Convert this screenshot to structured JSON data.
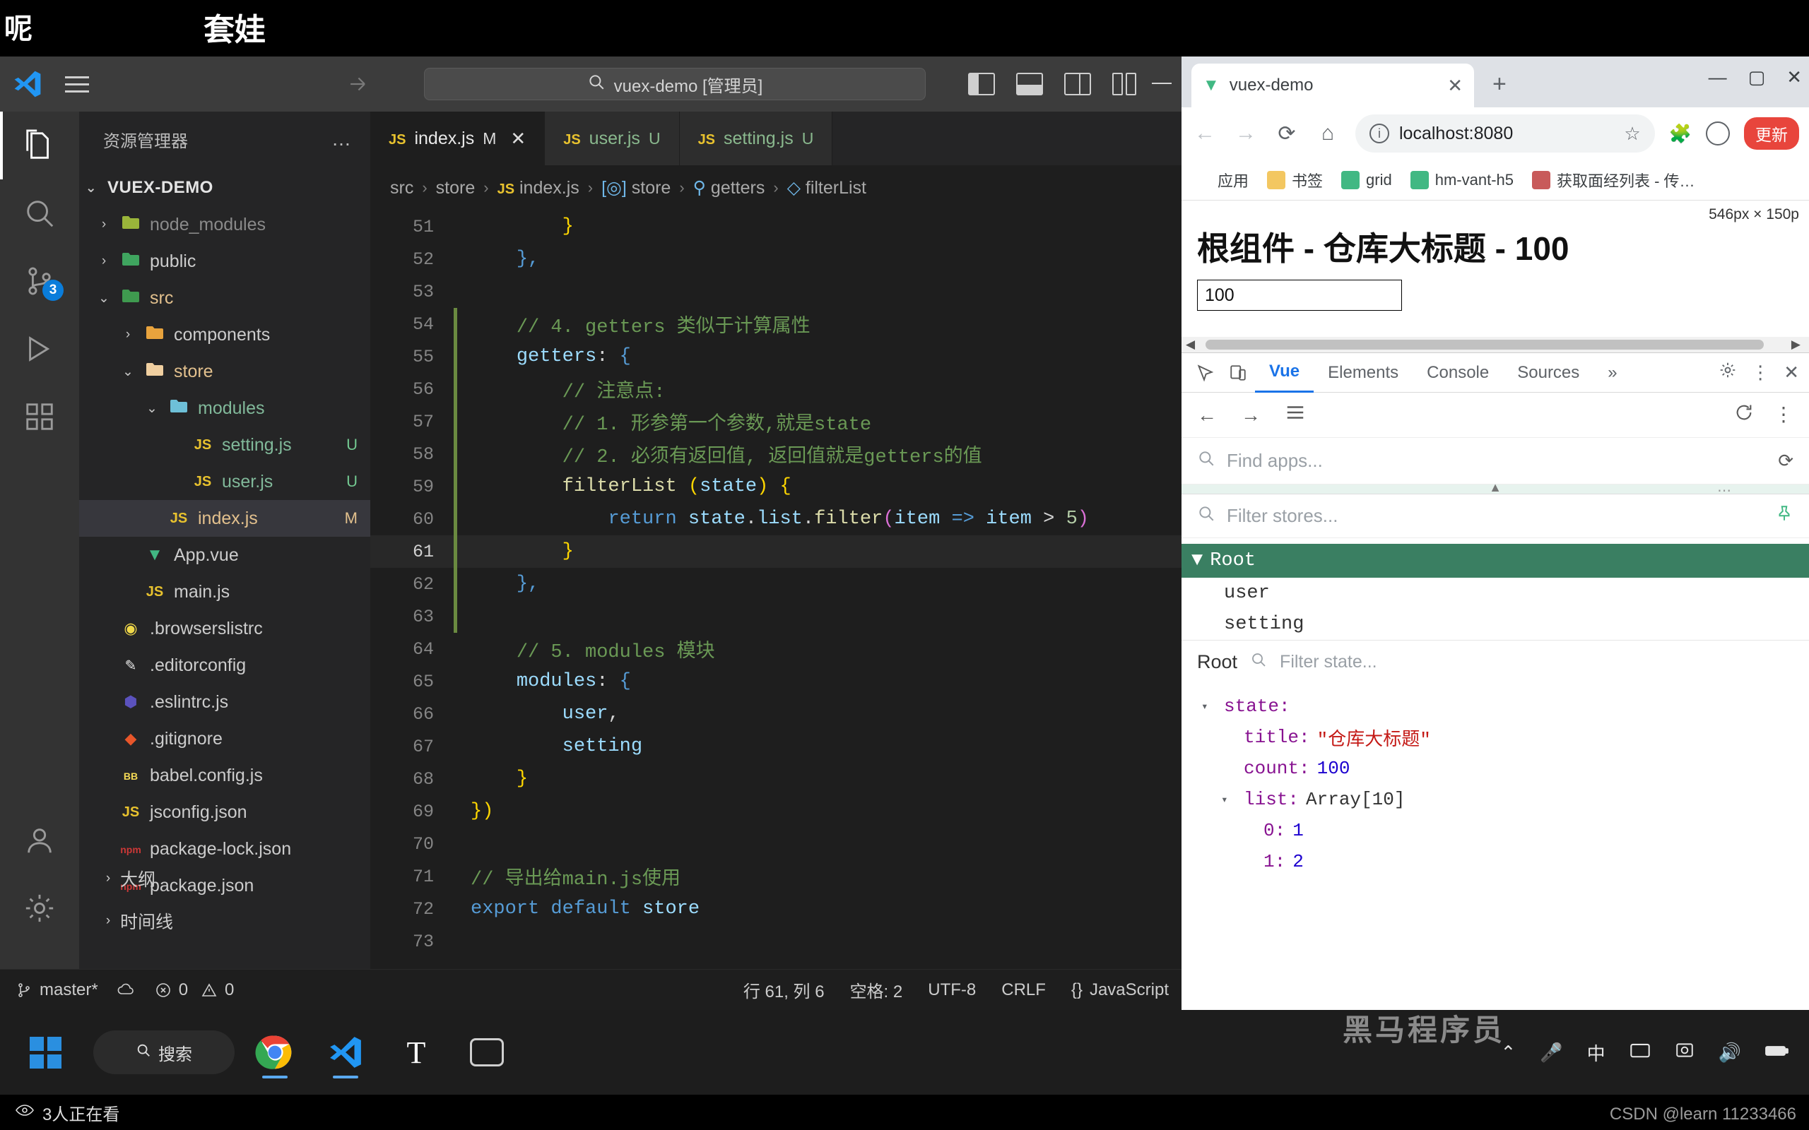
{
  "top_banner": {
    "text_left": "呢",
    "text_center": "套娃"
  },
  "vscode": {
    "titlebar": {
      "search_text": "vuex-demo [管理员]",
      "search_icon": "search-icon",
      "back_icon": "arrow-left-icon",
      "forward_icon": "arrow-right-icon",
      "layout_icons": [
        "toggle-primary-sidebar-icon",
        "toggle-panel-icon",
        "toggle-secondary-sidebar-icon",
        "customize-layout-icon"
      ],
      "minimize_label": "—"
    },
    "activitybar": {
      "items": [
        {
          "name": "explorer",
          "icon": "files-icon",
          "active": true,
          "badge": ""
        },
        {
          "name": "search",
          "icon": "search-icon",
          "active": false,
          "badge": ""
        },
        {
          "name": "source-control",
          "icon": "source-control-icon",
          "active": false,
          "badge": "3"
        },
        {
          "name": "run-and-debug",
          "icon": "run-debug-icon",
          "active": false,
          "badge": ""
        },
        {
          "name": "extensions",
          "icon": "extensions-icon",
          "active": false,
          "badge": ""
        }
      ],
      "bottom": [
        {
          "name": "accounts",
          "icon": "account-icon"
        },
        {
          "name": "settings",
          "icon": "gear-icon"
        }
      ]
    },
    "sidebar": {
      "title": "资源管理器",
      "more_label": "…",
      "root": "VUEX-DEMO",
      "tree": [
        {
          "label": "node_modules",
          "icon": "folder-node-icon",
          "chev": "›",
          "indent": 1,
          "color": "#8a8a8a",
          "badge": ""
        },
        {
          "label": "public",
          "icon": "folder-public-icon",
          "chev": "›",
          "indent": 1,
          "color": "#cccccc",
          "badge": ""
        },
        {
          "label": "src",
          "icon": "folder-src-icon",
          "chev": "⌄",
          "indent": 1,
          "color": "#e2c08d",
          "badge": ""
        },
        {
          "label": "components",
          "icon": "folder-components-icon",
          "chev": "›",
          "indent": 2,
          "color": "#cccccc",
          "badge": ""
        },
        {
          "label": "store",
          "icon": "folder-open-icon",
          "chev": "⌄",
          "indent": 2,
          "color": "#e2c08d",
          "badge": ""
        },
        {
          "label": "modules",
          "icon": "folder-modules-icon",
          "chev": "⌄",
          "indent": 3,
          "color": "#81b99a",
          "badge": ""
        },
        {
          "label": "setting.js",
          "icon": "js-icon",
          "chev": "",
          "indent": 4,
          "color": "#81b99a",
          "badge": "U"
        },
        {
          "label": "user.js",
          "icon": "js-icon",
          "chev": "",
          "indent": 4,
          "color": "#81b99a",
          "badge": "U"
        },
        {
          "label": "index.js",
          "icon": "js-icon",
          "chev": "",
          "indent": 3,
          "color": "#e2c08d",
          "badge": "M",
          "selected": true
        },
        {
          "label": "App.vue",
          "icon": "vue-icon",
          "chev": "",
          "indent": 2,
          "color": "#cccccc",
          "badge": ""
        },
        {
          "label": "main.js",
          "icon": "js-icon",
          "chev": "",
          "indent": 2,
          "color": "#cccccc",
          "badge": ""
        },
        {
          "label": ".browserslistrc",
          "icon": "browserslist-icon",
          "chev": "",
          "indent": 1,
          "color": "#cccccc",
          "badge": ""
        },
        {
          "label": ".editorconfig",
          "icon": "editorconfig-icon",
          "chev": "",
          "indent": 1,
          "color": "#cccccc",
          "badge": ""
        },
        {
          "label": ".eslintrc.js",
          "icon": "eslint-icon",
          "chev": "",
          "indent": 1,
          "color": "#cccccc",
          "badge": ""
        },
        {
          "label": ".gitignore",
          "icon": "git-icon",
          "chev": "",
          "indent": 1,
          "color": "#cccccc",
          "badge": ""
        },
        {
          "label": "babel.config.js",
          "icon": "babel-icon",
          "chev": "",
          "indent": 1,
          "color": "#cccccc",
          "badge": ""
        },
        {
          "label": "jsconfig.json",
          "icon": "js-icon",
          "chev": "",
          "indent": 1,
          "color": "#cccccc",
          "badge": ""
        },
        {
          "label": "package-lock.json",
          "icon": "npm-icon",
          "chev": "",
          "indent": 1,
          "color": "#cccccc",
          "badge": ""
        },
        {
          "label": "package.json",
          "icon": "npm-icon",
          "chev": "",
          "indent": 1,
          "color": "#cccccc",
          "badge": ""
        }
      ],
      "sections": [
        {
          "label": "大纲",
          "chev": "›"
        },
        {
          "label": "时间线",
          "chev": "›"
        }
      ]
    },
    "tabs": [
      {
        "label": "index.js",
        "icon": "js-icon",
        "badge": "M",
        "active": true,
        "close": "✕",
        "name_color": "#e8e8e8"
      },
      {
        "label": "user.js",
        "icon": "js-icon",
        "badge": "U",
        "active": false,
        "close": "",
        "name_color": "#8ab98e"
      },
      {
        "label": "setting.js",
        "icon": "js-icon",
        "badge": "U",
        "active": false,
        "close": "",
        "name_color": "#8ab98e"
      }
    ],
    "breadcrumbs": [
      "src",
      "store",
      "index.js",
      "store",
      "getters",
      "filterList"
    ],
    "code": [
      {
        "n": "51",
        "tokens": [
          {
            "t": "        ",
            "c": "op"
          },
          {
            "t": "}",
            "c": "pn"
          }
        ]
      },
      {
        "n": "52",
        "tokens": [
          {
            "t": "    ",
            "c": "op"
          },
          {
            "t": "},",
            "c": "kw"
          }
        ]
      },
      {
        "n": "53",
        "tokens": []
      },
      {
        "n": "54",
        "tokens": [
          {
            "t": "    ",
            "c": "op"
          },
          {
            "t": "// 4. getters 类似于计算属性",
            "c": "cmt"
          }
        ]
      },
      {
        "n": "55",
        "tokens": [
          {
            "t": "    ",
            "c": "op"
          },
          {
            "t": "getters",
            "c": "id"
          },
          {
            "t": ": ",
            "c": "op"
          },
          {
            "t": "{",
            "c": "kw"
          }
        ]
      },
      {
        "n": "56",
        "tokens": [
          {
            "t": "        ",
            "c": "op"
          },
          {
            "t": "// 注意点:",
            "c": "cmt"
          }
        ]
      },
      {
        "n": "57",
        "tokens": [
          {
            "t": "        ",
            "c": "op"
          },
          {
            "t": "// 1. 形参第一个参数,就是state",
            "c": "cmt"
          }
        ]
      },
      {
        "n": "58",
        "tokens": [
          {
            "t": "        ",
            "c": "op"
          },
          {
            "t": "// 2. 必须有返回值, 返回值就是getters的值",
            "c": "cmt"
          }
        ]
      },
      {
        "n": "59",
        "tokens": [
          {
            "t": "        ",
            "c": "op"
          },
          {
            "t": "filterList",
            "c": "fn"
          },
          {
            "t": " (",
            "c": "pn"
          },
          {
            "t": "state",
            "c": "id"
          },
          {
            "t": ") {",
            "c": "pn"
          }
        ]
      },
      {
        "n": "60",
        "tokens": [
          {
            "t": "            ",
            "c": "op"
          },
          {
            "t": "return",
            "c": "kw"
          },
          {
            "t": " ",
            "c": "op"
          },
          {
            "t": "state",
            "c": "id"
          },
          {
            "t": ".",
            "c": "op"
          },
          {
            "t": "list",
            "c": "id"
          },
          {
            "t": ".",
            "c": "op"
          },
          {
            "t": "filter",
            "c": "fn"
          },
          {
            "t": "(",
            "c": "pn2"
          },
          {
            "t": "item",
            "c": "id"
          },
          {
            "t": " => ",
            "c": "kw"
          },
          {
            "t": "item",
            "c": "id"
          },
          {
            "t": " > ",
            "c": "op"
          },
          {
            "t": "5",
            "c": "num"
          },
          {
            "t": ")",
            "c": "pn2"
          }
        ]
      },
      {
        "n": "61",
        "tokens": [
          {
            "t": "        ",
            "c": "op"
          },
          {
            "t": "}",
            "c": "pn"
          }
        ],
        "current": true
      },
      {
        "n": "62",
        "tokens": [
          {
            "t": "    ",
            "c": "op"
          },
          {
            "t": "},",
            "c": "kw"
          }
        ]
      },
      {
        "n": "63",
        "tokens": []
      },
      {
        "n": "64",
        "tokens": [
          {
            "t": "    ",
            "c": "op"
          },
          {
            "t": "// 5. modules 模块",
            "c": "cmt"
          }
        ]
      },
      {
        "n": "65",
        "tokens": [
          {
            "t": "    ",
            "c": "op"
          },
          {
            "t": "modules",
            "c": "id"
          },
          {
            "t": ": ",
            "c": "op"
          },
          {
            "t": "{",
            "c": "kw"
          }
        ]
      },
      {
        "n": "66",
        "tokens": [
          {
            "t": "        ",
            "c": "op"
          },
          {
            "t": "user",
            "c": "id"
          },
          {
            "t": ",",
            "c": "op"
          }
        ]
      },
      {
        "n": "67",
        "tokens": [
          {
            "t": "        ",
            "c": "op"
          },
          {
            "t": "setting",
            "c": "id"
          }
        ]
      },
      {
        "n": "68",
        "tokens": [
          {
            "t": "    ",
            "c": "op"
          },
          {
            "t": "}",
            "c": "pn"
          }
        ]
      },
      {
        "n": "69",
        "tokens": [
          {
            "t": "})",
            "c": "pn"
          }
        ]
      },
      {
        "n": "70",
        "tokens": []
      },
      {
        "n": "71",
        "tokens": [
          {
            "t": "// 导出给main.js使用",
            "c": "cmt"
          }
        ]
      },
      {
        "n": "72",
        "tokens": [
          {
            "t": "export",
            "c": "kw"
          },
          {
            "t": " ",
            "c": "op"
          },
          {
            "t": "default",
            "c": "kw"
          },
          {
            "t": " ",
            "c": "op"
          },
          {
            "t": "store",
            "c": "id"
          }
        ]
      },
      {
        "n": "73",
        "tokens": []
      }
    ],
    "statusbar": {
      "branch": "master*",
      "branch_icon": "source-control-icon",
      "sync_icon": "cloud-sync-icon",
      "errors": "0",
      "warnings": "0",
      "error_icon": "error-circle-icon",
      "warning_icon": "warning-triangle-icon",
      "cursor": "行 61, 列 6",
      "spaces": "空格: 2",
      "encoding": "UTF-8",
      "eol": "CRLF",
      "language": "JavaScript",
      "lang_icon": "braces-icon"
    }
  },
  "chrome": {
    "tab": {
      "title": "vuex-demo",
      "favicon": "vue-icon",
      "close": "✕"
    },
    "new_tab": "+",
    "window_controls": {
      "minimize": "—",
      "maximize": "▢",
      "close": "✕"
    },
    "toolbar": {
      "back": "←",
      "forward": "→",
      "reload": "⟳",
      "home": "⌂",
      "url": "localhost:8080",
      "star_icon": "bookmark-star-icon",
      "extensions_icon": "puzzle-piece-icon",
      "profile_icon": "account-icon",
      "update_label": "更新"
    },
    "bookmarks": [
      {
        "label": "应用",
        "icon": "apps-grid-icon"
      },
      {
        "label": "书签",
        "icon": "folder-icon"
      },
      {
        "label": "grid",
        "icon": "vue-icon"
      },
      {
        "label": "hm-vant-h5",
        "icon": "vue-icon"
      },
      {
        "label": "获取面经列表 - 传…",
        "icon": "page-icon"
      }
    ],
    "page": {
      "size_tip": "546px × 150p",
      "heading": "根组件 - 仓库大标题 - 100",
      "input_value": "100"
    },
    "devtools": {
      "icons": [
        "inspect-element-icon",
        "device-toolbar-icon"
      ],
      "tabs": [
        {
          "label": "Vue",
          "active": true
        },
        {
          "label": "Elements",
          "active": false
        },
        {
          "label": "Console",
          "active": false
        },
        {
          "label": "Sources",
          "active": false
        }
      ],
      "overflow": "»",
      "settings_icon": "gear-icon",
      "more_icon": "kebab-menu-icon",
      "close_icon": "close-icon",
      "vue_toolbar": {
        "back": "←",
        "forward": "→",
        "list_icon": "list-icon",
        "refresh_icon": "refresh-icon",
        "menu_icon": "kebab-menu-icon"
      },
      "find_apps_placeholder": "Find apps...",
      "filter_stores_placeholder": "Filter stores...",
      "store_tree": [
        {
          "label": "Root",
          "selected": true,
          "caret": "▼"
        },
        {
          "label": "user",
          "selected": false,
          "caret": ""
        },
        {
          "label": "setting",
          "selected": false,
          "caret": ""
        }
      ],
      "state_panel": {
        "title": "Root",
        "filter_placeholder": "Filter state...",
        "rows": [
          {
            "indent": 0,
            "caret": "▾",
            "key": "state",
            "value": "",
            "vtype": ""
          },
          {
            "indent": 1,
            "caret": "",
            "key": "title",
            "value": "\"仓库大标题\"",
            "vtype": "str"
          },
          {
            "indent": 1,
            "caret": "",
            "key": "count",
            "value": "100",
            "vtype": "num"
          },
          {
            "indent": 1,
            "caret": "▾",
            "key": "list",
            "value": "Array[10]",
            "vtype": "plain"
          },
          {
            "indent": 2,
            "caret": "",
            "key": "0",
            "value": "1",
            "vtype": "num"
          },
          {
            "indent": 2,
            "caret": "",
            "key": "1",
            "value": "2",
            "vtype": "num"
          }
        ]
      }
    }
  },
  "taskbar": {
    "start_icon": "windows-logo-icon",
    "search_label": "搜索",
    "search_icon": "search-icon",
    "apps": [
      {
        "name": "chrome-icon",
        "running": true
      },
      {
        "name": "vscode-icon",
        "running": true
      },
      {
        "name": "typora-icon",
        "running": false
      },
      {
        "name": "recorder-icon",
        "running": false
      }
    ],
    "tray": [
      "chevron-up-icon",
      "microphone-icon",
      "ime-icon",
      "screenshot-icon",
      "capture-icon",
      "volume-icon",
      "battery-icon"
    ],
    "watermark": "黑马程序员"
  },
  "bottom_bar": {
    "viewers": "3人正在看",
    "viewer_icon": "eye-icon"
  },
  "credit": "CSDN @learn 11233466"
}
